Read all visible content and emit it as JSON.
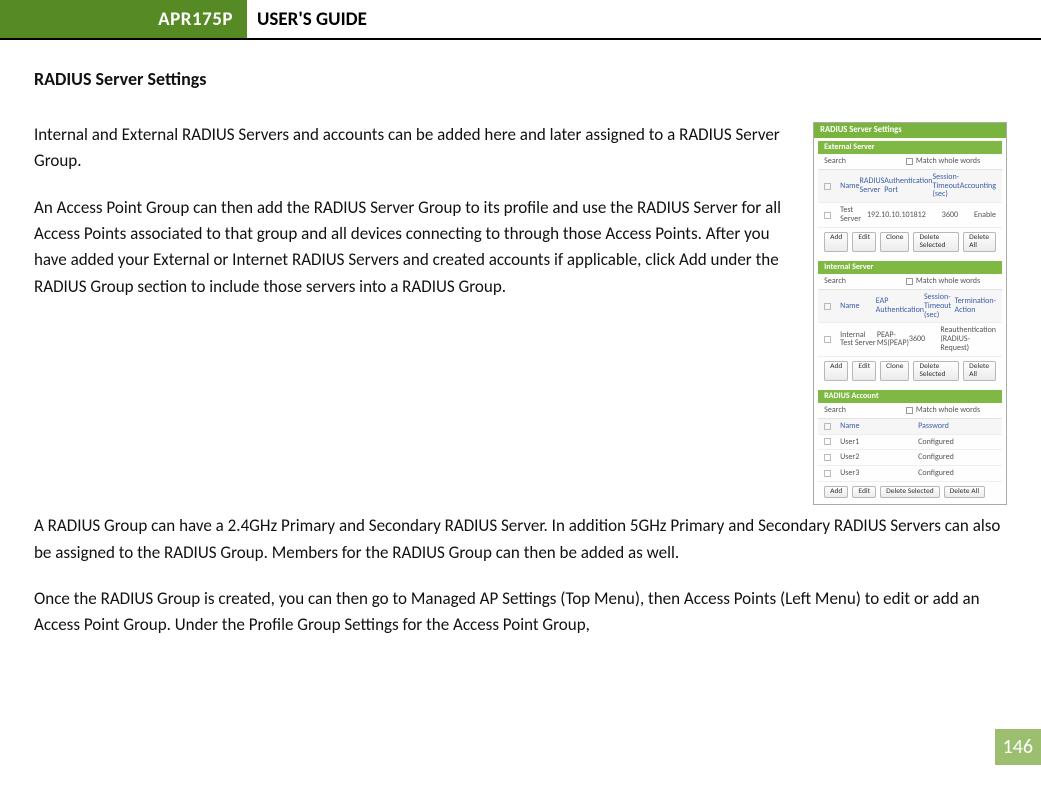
{
  "header": {
    "product": "APR175P",
    "title": "USER'S GUIDE"
  },
  "section_title": "RADIUS Server Settings",
  "paragraphs": [
    "Internal and External RADIUS Servers and accounts can be added here and later assigned to a RADIUS Server Group.",
    "An Access Point Group can then add the RADIUS Server Group to its profile and use the RADIUS Server for all Access Points associated to that group and all devices connecting to through those Access Points.  After you have added your External or Internet RADIUS Servers and created accounts if applicable, click Add under the RADIUS Group section to include those servers into a RADIUS Group.",
    "A RADIUS Group can have a 2.4GHz Primary and Secondary RADIUS Server.  In addition 5GHz Primary and Secondary RADIUS Servers can also be assigned to the RADIUS Group. Members for the RADIUS Group can then be added as well.",
    "Once the RADIUS Group is created, you can then go to Managed AP Settings (Top Menu), then Access Points (Left Menu) to edit or add an Access Point Group. Under the Profile Group Settings for the Access Point Group,"
  ],
  "shot": {
    "main_title": "RADIUS Server Settings",
    "search_label": "Search",
    "match_label": "Match whole words",
    "buttons": {
      "add": "Add",
      "edit": "Edit",
      "clone": "Clone",
      "del_sel": "Delete Selected",
      "del_all": "Delete All"
    },
    "external": {
      "bar": "External Server",
      "headers": [
        "Name",
        "RADIUS Server",
        "Authentication Port",
        "Session-Timeout (sec)",
        "Accounting"
      ],
      "row": [
        "Test Server",
        "192.10.10.10",
        "1812",
        "3600",
        "Enable"
      ]
    },
    "internal": {
      "bar": "Internal Server",
      "headers": [
        "Name",
        "EAP Authentication",
        "Session-Timeout (sec)",
        "Termination-Action"
      ],
      "row": [
        "Internal Test Server",
        "PEAP-MS(PEAP)",
        "3600",
        "Reauthentication (RADIUS-Request)"
      ]
    },
    "accounts": {
      "bar": "RADIUS Account",
      "headers": [
        "Name",
        "Password"
      ],
      "rows": [
        [
          "User1",
          "Configured"
        ],
        [
          "User2",
          "Configured"
        ],
        [
          "User3",
          "Configured"
        ]
      ]
    }
  },
  "page_number": "146"
}
